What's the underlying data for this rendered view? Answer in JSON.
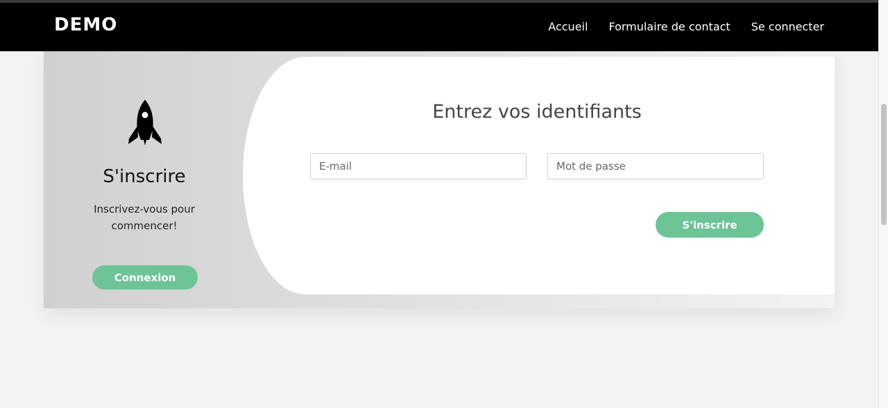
{
  "navbar": {
    "brand": "DEMO",
    "links": [
      "Accueil",
      "Formulaire de contact",
      "Se connecter"
    ]
  },
  "left": {
    "icon": "rocket-icon",
    "title": "S'inscrire",
    "subtitle": "Inscrivez-vous pour commencer!",
    "button": "Connexion"
  },
  "form": {
    "title": "Entrez vos identifiants",
    "email_placeholder": "E-mail",
    "password_placeholder": "Mot de passe",
    "submit": "S'inscrire"
  },
  "colors": {
    "accent": "#6dc497",
    "navbar": "#000000"
  }
}
